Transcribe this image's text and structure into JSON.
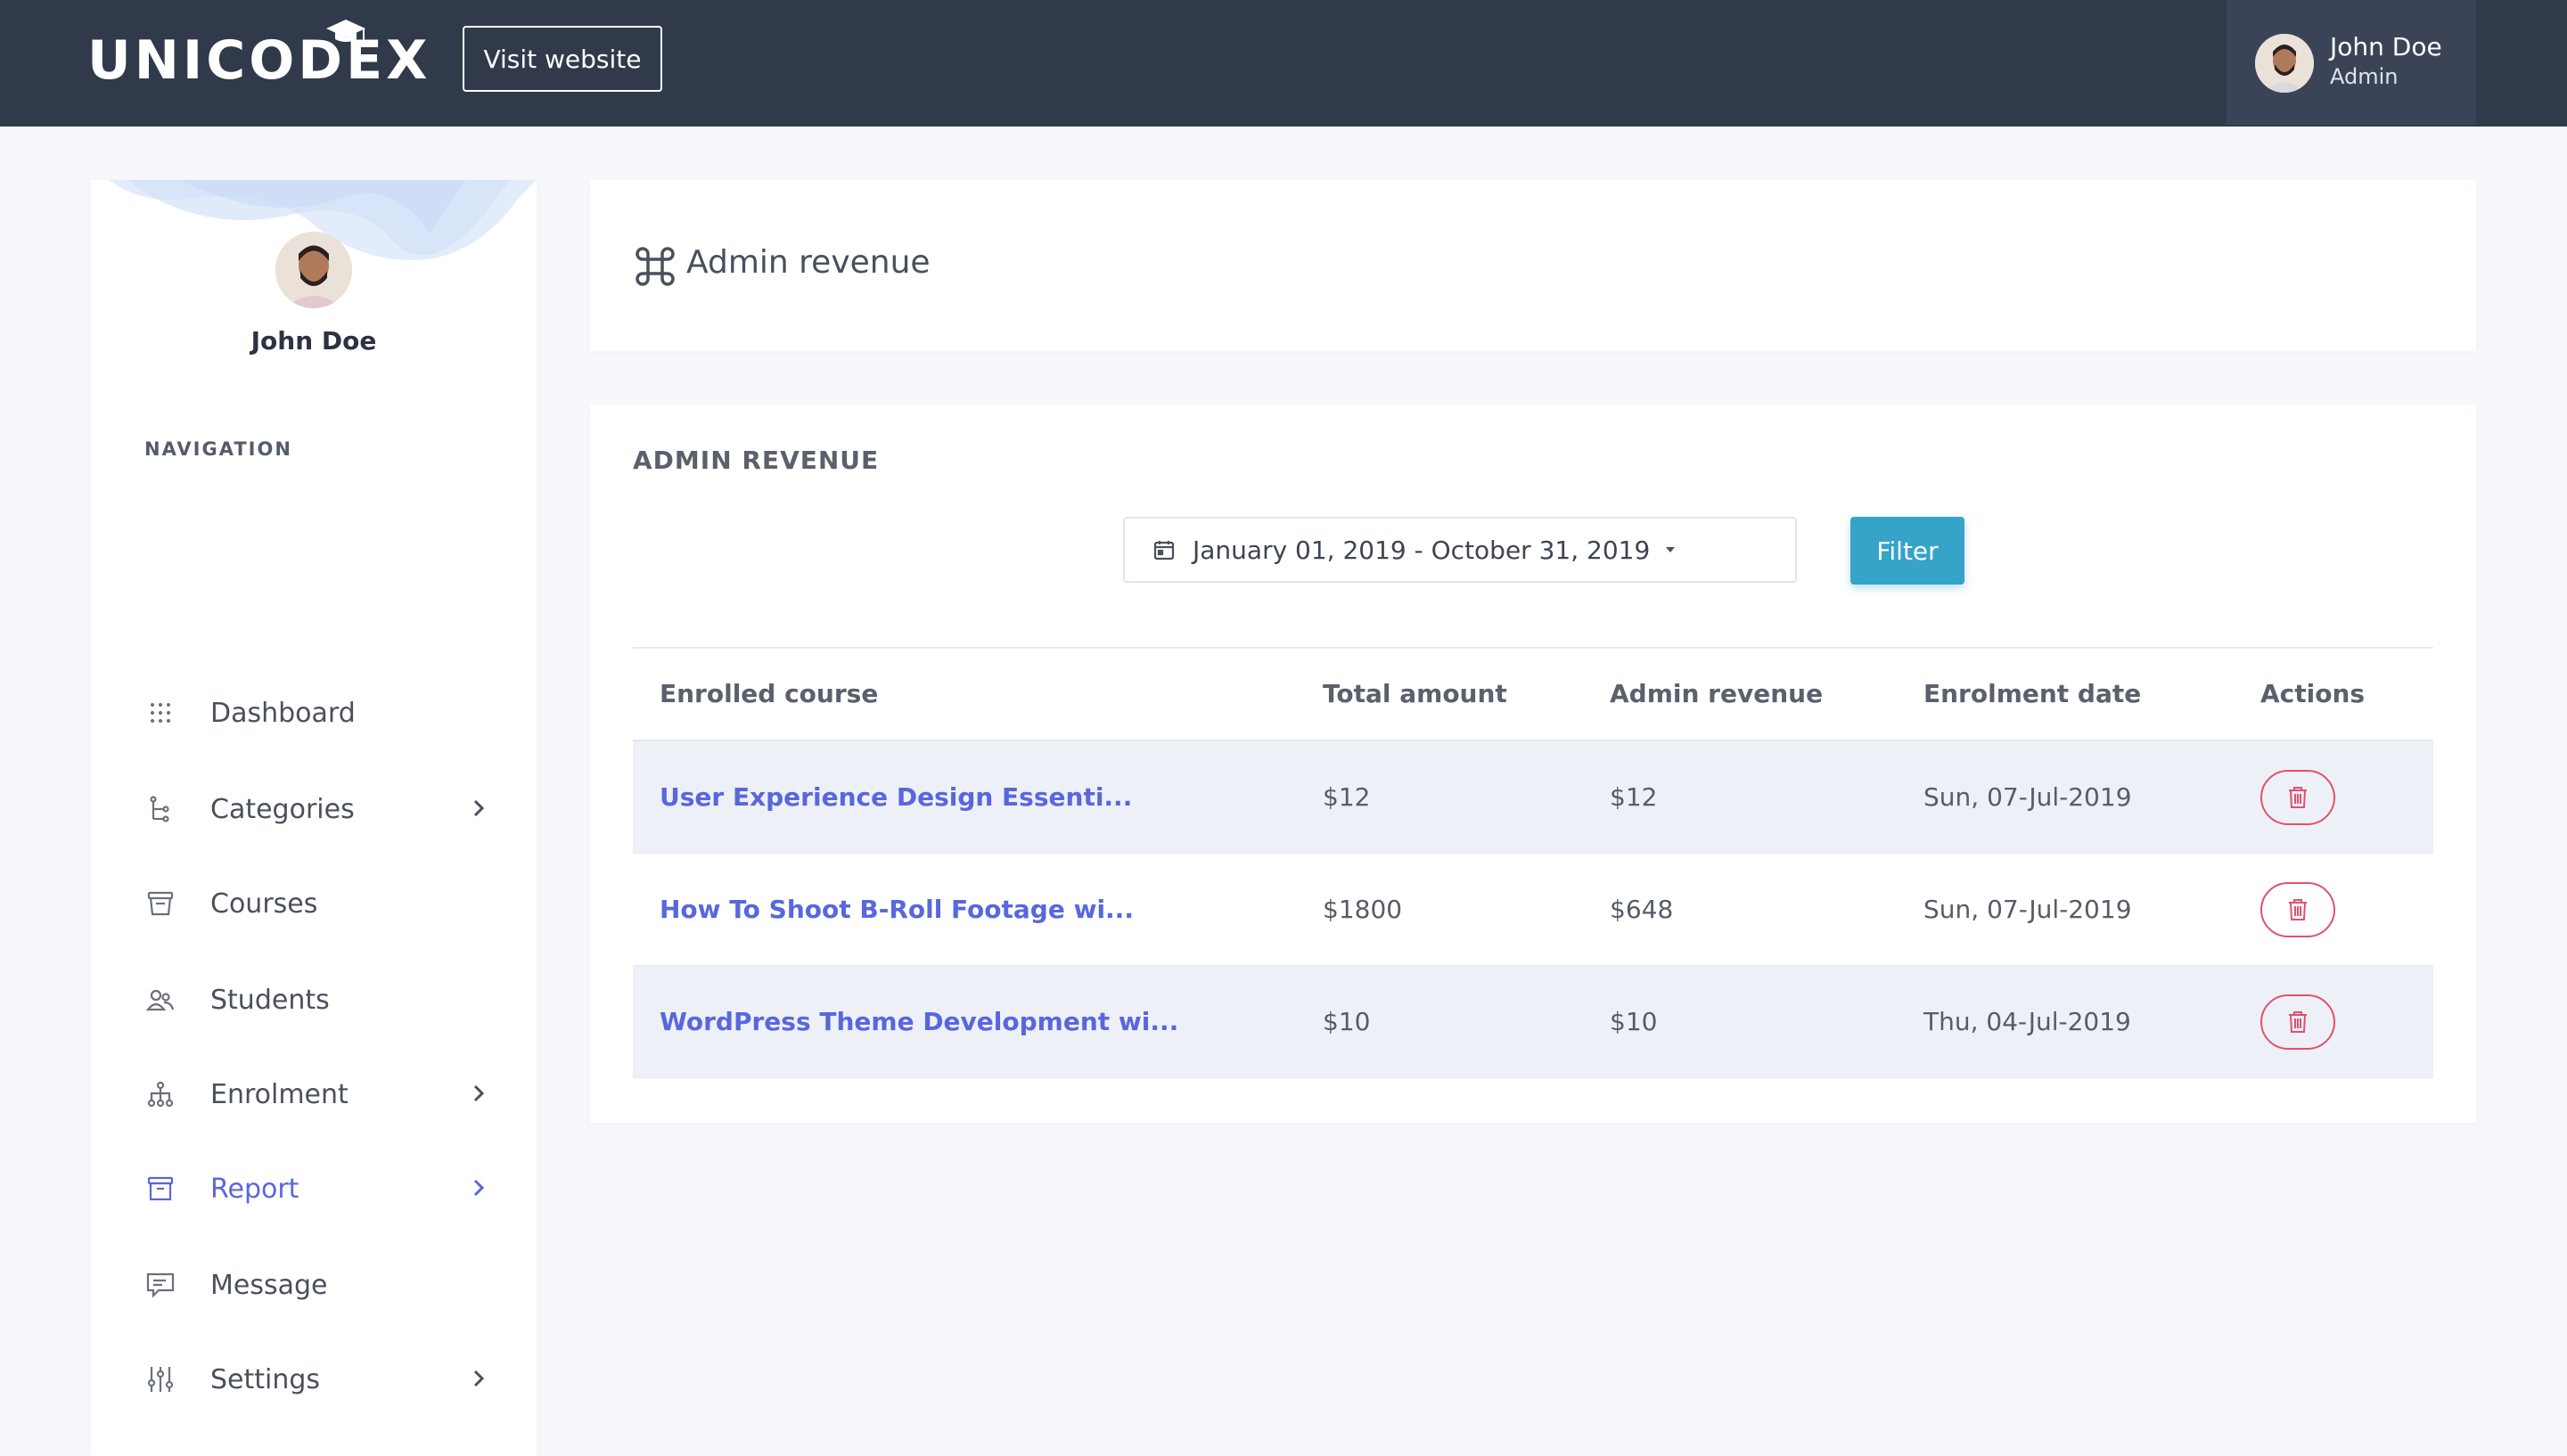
{
  "topbar": {
    "logo_text": "UNICODEX",
    "visit_label": "Visit website",
    "user_name": "John Doe",
    "user_role": "Admin"
  },
  "sidebar": {
    "user_name": "John Doe",
    "nav_heading": "NAVIGATION",
    "items": [
      {
        "label": "Dashboard",
        "icon": "grid-icon",
        "has_submenu": false
      },
      {
        "label": "Categories",
        "icon": "tree-icon",
        "has_submenu": true
      },
      {
        "label": "Courses",
        "icon": "archive-icon",
        "has_submenu": false
      },
      {
        "label": "Students",
        "icon": "users-icon",
        "has_submenu": false
      },
      {
        "label": "Enrolment",
        "icon": "network-icon",
        "has_submenu": true
      },
      {
        "label": "Report",
        "icon": "box-icon",
        "has_submenu": true,
        "active": true
      },
      {
        "label": "Message",
        "icon": "chat-icon",
        "has_submenu": false
      },
      {
        "label": "Settings",
        "icon": "sliders-icon",
        "has_submenu": true
      }
    ]
  },
  "header": {
    "title": "Admin revenue",
    "icon": "command-icon"
  },
  "revenue": {
    "section_title": "ADMIN REVENUE",
    "date_range": "January 01, 2019 - October 31, 2019",
    "filter_label": "Filter",
    "columns": [
      "Enrolled course",
      "Total amount",
      "Admin revenue",
      "Enrolment date",
      "Actions"
    ],
    "rows": [
      {
        "course": "User Experience Design Essenti...",
        "total": "$12",
        "admin": "$12",
        "date": "Sun, 07-Jul-2019"
      },
      {
        "course": "How To Shoot B-Roll Footage wi...",
        "total": "$1800",
        "admin": "$648",
        "date": "Sun, 07-Jul-2019"
      },
      {
        "course": "WordPress Theme Development wi...",
        "total": "$10",
        "admin": "$10",
        "date": "Thu, 04-Jul-2019"
      }
    ]
  },
  "colors": {
    "topbar": "#313a4b",
    "accent": "#5867dd",
    "filter": "#36a3c9",
    "danger": "#e0516c"
  }
}
